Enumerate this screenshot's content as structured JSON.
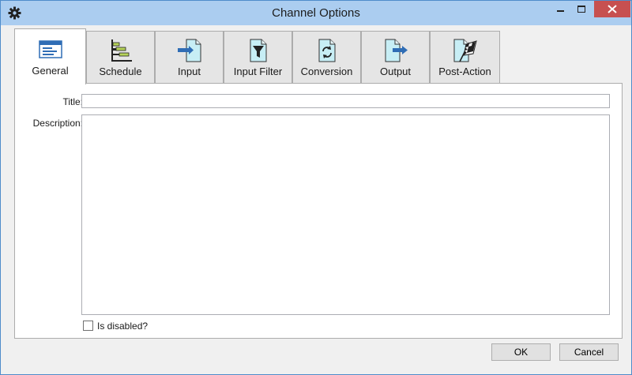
{
  "window": {
    "title": "Channel Options",
    "app_icon": "gear-icon",
    "controls": [
      "minimize-icon",
      "maximize-icon",
      "close-icon"
    ]
  },
  "tabs": [
    {
      "label": "General",
      "icon": "window-form-icon",
      "active": true
    },
    {
      "label": "Schedule",
      "icon": "schedule-gantt-icon",
      "active": false
    },
    {
      "label": "Input",
      "icon": "document-input-arrow-icon",
      "active": false
    },
    {
      "label": "Input Filter",
      "icon": "document-funnel-icon",
      "active": false
    },
    {
      "label": "Conversion",
      "icon": "document-refresh-icon",
      "active": false
    },
    {
      "label": "Output",
      "icon": "document-output-arrow-icon",
      "active": false
    },
    {
      "label": "Post-Action",
      "icon": "document-checkered-flag-icon",
      "active": false
    }
  ],
  "form": {
    "title_label": "Title:",
    "title_value": "",
    "description_label": "Description:",
    "description_value": "",
    "disabled_label": "Is disabled?",
    "disabled_checked": false
  },
  "buttons": {
    "ok": "OK",
    "cancel": "Cancel"
  },
  "colors": {
    "titlebar": "#abcdf0",
    "close_button": "#c75050",
    "accent_blue": "#2f6db5"
  }
}
